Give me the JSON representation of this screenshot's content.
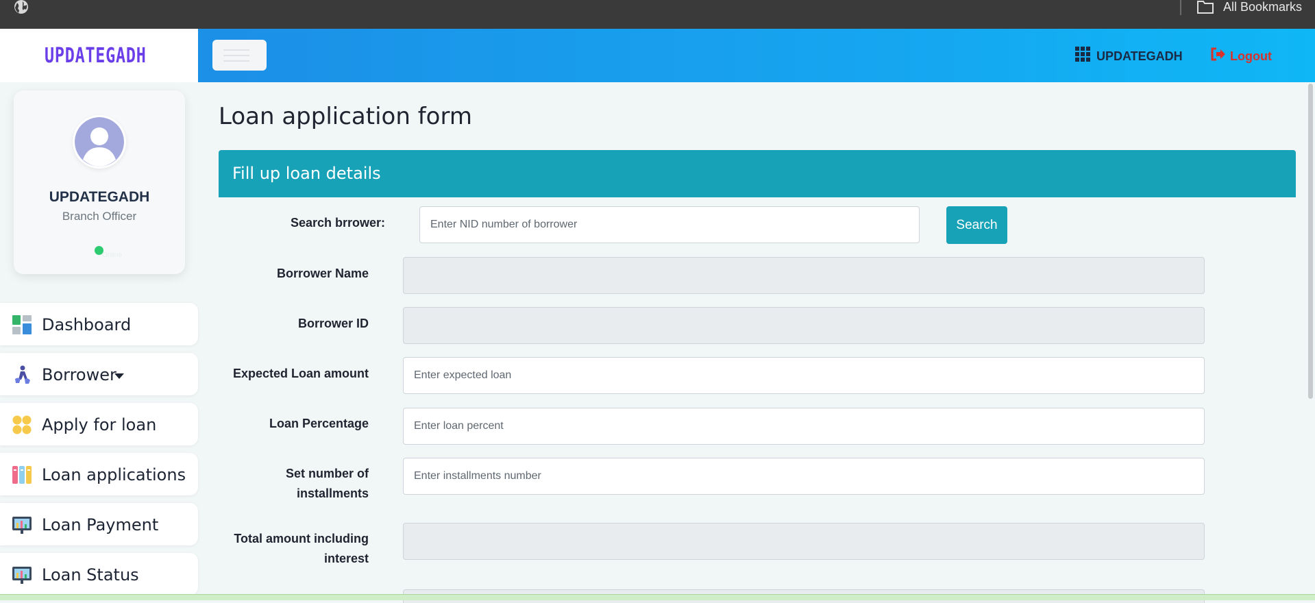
{
  "browser": {
    "bookmarks_label": "All Bookmarks"
  },
  "brand": {
    "logo_text": "UPDATEGADH",
    "logo_color": "#6a3ee8"
  },
  "topbar": {
    "app_link": "UPDATEGADH",
    "logout": "Logout",
    "gradient_start": "#1c8fe6",
    "gradient_end": "#0fb7f6"
  },
  "profile": {
    "name": "UPDATEGADH",
    "role": "Branch Officer",
    "status": "Online"
  },
  "sidebar": {
    "items": [
      {
        "label": "Dashboard",
        "icon": "dashboard-icon"
      },
      {
        "label": "Borrower",
        "icon": "borrower-icon",
        "has_dropdown": true
      },
      {
        "label": "Apply for loan",
        "icon": "apply-loan-icon"
      },
      {
        "label": "Loan applications",
        "icon": "loan-applications-icon"
      },
      {
        "label": "Loan Payment",
        "icon": "loan-payment-icon"
      },
      {
        "label": "Loan Status",
        "icon": "loan-status-icon"
      }
    ]
  },
  "main": {
    "title": "Loan application form",
    "card_title": "Fill up loan details",
    "accent_color": "#18a2b8",
    "form": {
      "search_label": "Search brrower:",
      "search_placeholder": "Enter NID number of borrower",
      "search_button": "Search",
      "borrower_name_label": "Borrower Name",
      "borrower_id_label": "Borrower ID",
      "expected_loan_label": "Expected Loan amount",
      "expected_loan_placeholder": "Enter expected loan",
      "loan_percentage_label": "Loan Percentage",
      "loan_percentage_placeholder": "Enter loan percent",
      "installments_label_line1": "Set number of",
      "installments_label_line2": "installments",
      "installments_placeholder": "Enter installments number",
      "total_label_line1": "Total amount including",
      "total_label_line2": "interest"
    }
  }
}
